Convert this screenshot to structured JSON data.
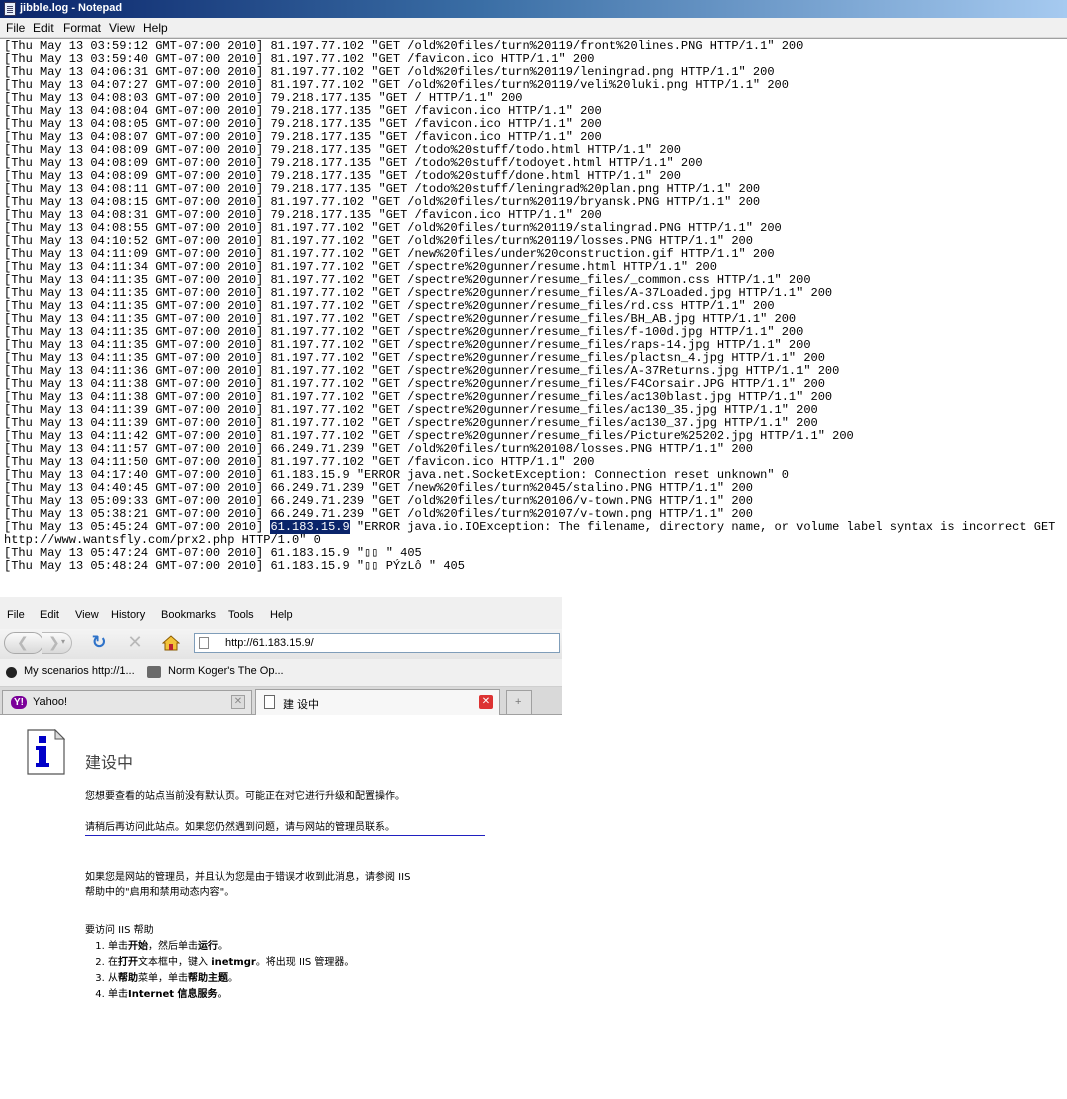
{
  "notepad": {
    "title": "jibble.log - Notepad",
    "menu": [
      "File",
      "Edit",
      "Format",
      "View",
      "Help"
    ],
    "log_lines": [
      "[Thu May 13 03:59:12 GMT-07:00 2010] 81.197.77.102 \"GET /old%20files/turn%20119/front%20lines.PNG HTTP/1.1\" 200",
      "[Thu May 13 03:59:40 GMT-07:00 2010] 81.197.77.102 \"GET /favicon.ico HTTP/1.1\" 200",
      "[Thu May 13 04:06:31 GMT-07:00 2010] 81.197.77.102 \"GET /old%20files/turn%20119/leningrad.png HTTP/1.1\" 200",
      "[Thu May 13 04:07:27 GMT-07:00 2010] 81.197.77.102 \"GET /old%20files/turn%20119/veli%20luki.png HTTP/1.1\" 200",
      "[Thu May 13 04:08:03 GMT-07:00 2010] 79.218.177.135 \"GET / HTTP/1.1\" 200",
      "[Thu May 13 04:08:04 GMT-07:00 2010] 79.218.177.135 \"GET /favicon.ico HTTP/1.1\" 200",
      "[Thu May 13 04:08:05 GMT-07:00 2010] 79.218.177.135 \"GET /favicon.ico HTTP/1.1\" 200",
      "[Thu May 13 04:08:07 GMT-07:00 2010] 79.218.177.135 \"GET /favicon.ico HTTP/1.1\" 200",
      "[Thu May 13 04:08:09 GMT-07:00 2010] 79.218.177.135 \"GET /todo%20stuff/todo.html HTTP/1.1\" 200",
      "[Thu May 13 04:08:09 GMT-07:00 2010] 79.218.177.135 \"GET /todo%20stuff/todoyet.html HTTP/1.1\" 200",
      "[Thu May 13 04:08:09 GMT-07:00 2010] 79.218.177.135 \"GET /todo%20stuff/done.html HTTP/1.1\" 200",
      "[Thu May 13 04:08:11 GMT-07:00 2010] 79.218.177.135 \"GET /todo%20stuff/leningrad%20plan.png HTTP/1.1\" 200",
      "[Thu May 13 04:08:15 GMT-07:00 2010] 81.197.77.102 \"GET /old%20files/turn%20119/bryansk.PNG HTTP/1.1\" 200",
      "[Thu May 13 04:08:31 GMT-07:00 2010] 79.218.177.135 \"GET /favicon.ico HTTP/1.1\" 200",
      "[Thu May 13 04:08:55 GMT-07:00 2010] 81.197.77.102 \"GET /old%20files/turn%20119/stalingrad.PNG HTTP/1.1\" 200",
      "[Thu May 13 04:10:52 GMT-07:00 2010] 81.197.77.102 \"GET /old%20files/turn%20119/losses.PNG HTTP/1.1\" 200",
      "[Thu May 13 04:11:09 GMT-07:00 2010] 81.197.77.102 \"GET /new%20files/under%20construction.gif HTTP/1.1\" 200",
      "[Thu May 13 04:11:34 GMT-07:00 2010] 81.197.77.102 \"GET /spectre%20gunner/resume.html HTTP/1.1\" 200",
      "[Thu May 13 04:11:35 GMT-07:00 2010] 81.197.77.102 \"GET /spectre%20gunner/resume_files/_common.css HTTP/1.1\" 200",
      "[Thu May 13 04:11:35 GMT-07:00 2010] 81.197.77.102 \"GET /spectre%20gunner/resume_files/A-37Loaded.jpg HTTP/1.1\" 200",
      "[Thu May 13 04:11:35 GMT-07:00 2010] 81.197.77.102 \"GET /spectre%20gunner/resume_files/rd.css HTTP/1.1\" 200",
      "[Thu May 13 04:11:35 GMT-07:00 2010] 81.197.77.102 \"GET /spectre%20gunner/resume_files/BH_AB.jpg HTTP/1.1\" 200",
      "[Thu May 13 04:11:35 GMT-07:00 2010] 81.197.77.102 \"GET /spectre%20gunner/resume_files/f-100d.jpg HTTP/1.1\" 200",
      "[Thu May 13 04:11:35 GMT-07:00 2010] 81.197.77.102 \"GET /spectre%20gunner/resume_files/raps-14.jpg HTTP/1.1\" 200",
      "[Thu May 13 04:11:35 GMT-07:00 2010] 81.197.77.102 \"GET /spectre%20gunner/resume_files/plactsn_4.jpg HTTP/1.1\" 200",
      "[Thu May 13 04:11:36 GMT-07:00 2010] 81.197.77.102 \"GET /spectre%20gunner/resume_files/A-37Returns.jpg HTTP/1.1\" 200",
      "[Thu May 13 04:11:38 GMT-07:00 2010] 81.197.77.102 \"GET /spectre%20gunner/resume_files/F4Corsair.JPG HTTP/1.1\" 200",
      "[Thu May 13 04:11:38 GMT-07:00 2010] 81.197.77.102 \"GET /spectre%20gunner/resume_files/ac130blast.jpg HTTP/1.1\" 200",
      "[Thu May 13 04:11:39 GMT-07:00 2010] 81.197.77.102 \"GET /spectre%20gunner/resume_files/ac130_35.jpg HTTP/1.1\" 200",
      "[Thu May 13 04:11:39 GMT-07:00 2010] 81.197.77.102 \"GET /spectre%20gunner/resume_files/ac130_37.jpg HTTP/1.1\" 200",
      "[Thu May 13 04:11:42 GMT-07:00 2010] 81.197.77.102 \"GET /spectre%20gunner/resume_files/Picture%25202.jpg HTTP/1.1\" 200",
      "[Thu May 13 04:11:57 GMT-07:00 2010] 66.249.71.239 \"GET /old%20files/turn%20108/losses.PNG HTTP/1.1\" 200",
      "[Thu May 13 04:11:50 GMT-07:00 2010] 81.197.77.102 \"GET /favicon.ico HTTP/1.1\" 200",
      "[Thu May 13 04:17:40 GMT-07:00 2010] 61.183.15.9 \"ERROR java.net.SocketException: Connection reset unknown\" 0",
      "[Thu May 13 04:40:45 GMT-07:00 2010] 66.249.71.239 \"GET /new%20files/turn%2045/stalino.PNG HTTP/1.1\" 200",
      "[Thu May 13 05:09:33 GMT-07:00 2010] 66.249.71.239 \"GET /old%20files/turn%20106/v-town.PNG HTTP/1.1\" 200",
      "[Thu May 13 05:38:21 GMT-07:00 2010] 66.249.71.239 \"GET /old%20files/turn%20107/v-town.png HTTP/1.1\" 200"
    ],
    "error_line": {
      "prefix": "[Thu May 13 05:45:24 GMT-07:00 2010] ",
      "highlight": "61.183.15.9",
      "suffix": " \"ERROR java.io.IOException: The filename, directory name, or volume label syntax is incorrect GET http://www.wantsfly.com/prx2.php HTTP/1.0\" 0"
    },
    "tail_lines": [
      "[Thu May 13 05:47:24 GMT-07:00 2010] 61.183.15.9 \"▯▯ \" 405",
      "[Thu May 13 05:48:24 GMT-07:00 2010] 61.183.15.9 \"▯▯ PÝzLô \" 405"
    ],
    "highlight_color": "#0a246a"
  },
  "firefox": {
    "menu": [
      "File",
      "Edit",
      "View",
      "History",
      "Bookmarks",
      "Tools",
      "Help"
    ],
    "nav": {
      "back_icon": "back-arrow-icon",
      "forward_icon": "forward-arrow-icon",
      "reload_icon": "reload-icon",
      "stop_icon": "stop-icon",
      "home_icon": "home-icon",
      "url": "http://61.183.15.9/"
    },
    "bookmarks": [
      {
        "label": "My scenarios http://1..."
      },
      {
        "label": "Norm Koger's The Op..."
      }
    ],
    "tabs": [
      {
        "label": "Yahoo!",
        "active": false
      },
      {
        "label": "建 设中",
        "active": true
      }
    ],
    "tab_close_color": "#d33333"
  },
  "page": {
    "title": "建设中",
    "p1": "您想要查看的站点当前没有默认页。可能正在对它进行升级和配置操作。",
    "p2": "请稍后再访问此站点。如果您仍然遇到问题，请与网站的管理员联系。",
    "p3_line1": "如果您是网站的管理员，并且认为您是由于错误才收到此消息，请参阅 IIS",
    "p3_line2": "帮助中的\"启用和禁用动态内容\"。",
    "p4": "要访问 IIS 帮助",
    "steps": [
      {
        "a": "单击",
        "b": "开始",
        "c": "，然后单击",
        "d": "运行",
        "e": "。"
      },
      {
        "a": "在",
        "b": "打开",
        "c": "文本框中，键入 ",
        "d": "inetmgr",
        "e": "。将出现 IIS 管理器。"
      },
      {
        "a": "从",
        "b": "帮助",
        "c": "菜单，单击",
        "d": "帮助主题",
        "e": "。"
      },
      {
        "a": "单击",
        "b": "Internet 信息服务",
        "c": "。",
        "d": "",
        "e": ""
      }
    ],
    "divider_color": "#2020c0",
    "info_icon": "info-icon"
  }
}
